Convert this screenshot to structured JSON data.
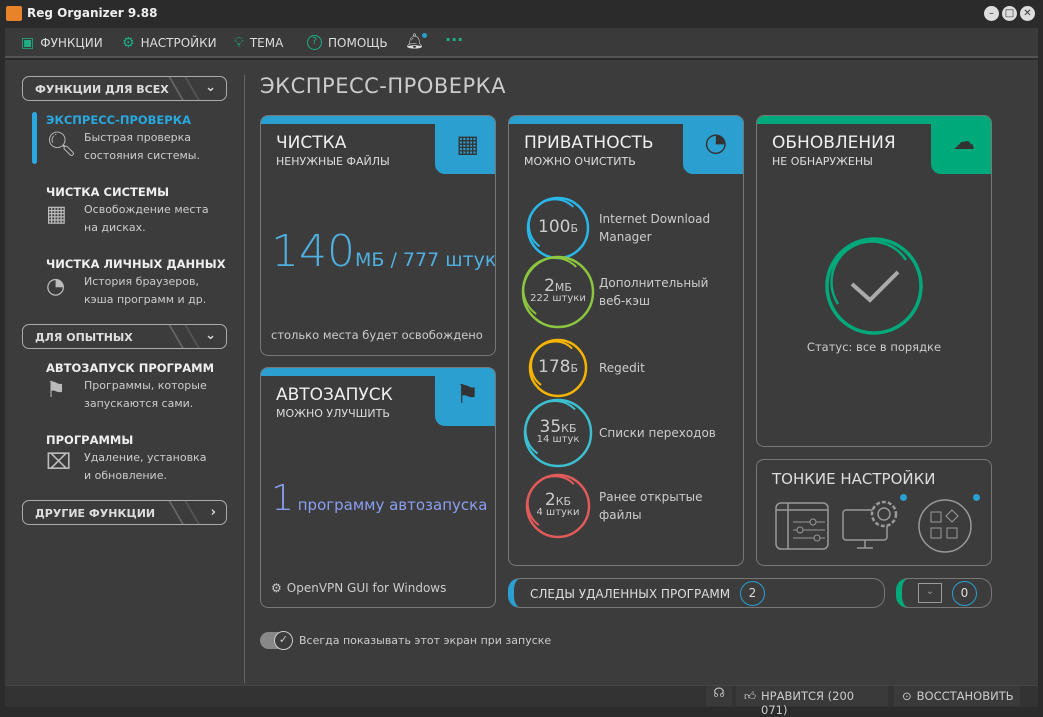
{
  "window": {
    "title": "Reg Organizer 9.88"
  },
  "menu": [
    {
      "label": "ФУНКЦИИ",
      "icon": "briefcase-icon"
    },
    {
      "label": "НАСТРОЙКИ",
      "icon": "gear-icon"
    },
    {
      "label": "ТЕМА",
      "icon": "lightbulb-icon"
    },
    {
      "label": "ПОМОЩЬ",
      "icon": "help-icon"
    }
  ],
  "sidebar": {
    "group1": "ФУНКЦИИ ДЛЯ ВСЕХ",
    "group2": "ДЛЯ ОПЫТНЫХ",
    "group3": "ДРУГИЕ ФУНКЦИИ",
    "items": [
      {
        "title": "ЭКСПРЕСС-ПРОВЕРКА",
        "desc1": "Быстрая проверка",
        "desc2": "состояния системы."
      },
      {
        "title": "ЧИСТКА СИСТЕМЫ",
        "desc1": "Освобождение места",
        "desc2": "на дисках."
      },
      {
        "title": "ЧИСТКА ЛИЧНЫХ ДАННЫХ",
        "desc1": "История браузеров,",
        "desc2": "кэша программ и др."
      },
      {
        "title": "АВТОЗАПУСК ПРОГРАММ",
        "desc1": "Программы, которые",
        "desc2": "запускаются сами."
      },
      {
        "title": "ПРОГРАММЫ",
        "desc1": "Удаление, установка",
        "desc2": "и обновление."
      }
    ]
  },
  "page_title": "ЭКСПРЕСС-ПРОВЕРКА",
  "cleanup": {
    "title": "ЧИСТКА",
    "subtitle": "НЕНУЖНЫЕ ФАЙЛЫ",
    "size": "140",
    "size_unit": "МБ / 777 штук",
    "note": "столько места будет освобождено"
  },
  "autorun": {
    "title": "АВТОЗАПУСК",
    "subtitle": "МОЖНО УЛУЧШИТЬ",
    "count": "1",
    "count_label": "программу автозапуска",
    "item": "OpenVPN GUI for Windows"
  },
  "privacy": {
    "title": "ПРИВАТНОСТЬ",
    "subtitle": "МОЖНО ОЧИСТИТЬ",
    "items": [
      {
        "value": "100",
        "unit": "Б",
        "count": "",
        "label1": "Internet Download",
        "label2": "Manager",
        "color": "#29b6e8"
      },
      {
        "value": "2",
        "unit": "МБ",
        "count": "222 штуки",
        "label1": "Дополнительный",
        "label2": "веб-кэш",
        "color": "#8cc63f"
      },
      {
        "value": "178",
        "unit": "Б",
        "count": "",
        "label1": "Regedit",
        "label2": "",
        "color": "#f5b400"
      },
      {
        "value": "35",
        "unit": "КБ",
        "count": "14 штук",
        "label1": "Списки переходов",
        "label2": "",
        "color": "#3cbfd0"
      },
      {
        "value": "2",
        "unit": "КБ",
        "count": "4 штуки",
        "label1": "Ранее открытые",
        "label2": "файлы",
        "color": "#e05a5a"
      }
    ]
  },
  "updates": {
    "title": "ОБНОВЛЕНИЯ",
    "subtitle": "НЕ ОБНАРУЖЕНЫ",
    "status": "Статус: все в порядке"
  },
  "tweaks": {
    "title": "ТОНКИЕ НАСТРОЙКИ"
  },
  "traces": {
    "label": "СЛЕДЫ УДАЛЕННЫХ ПРОГРАММ",
    "count": "2"
  },
  "memory": {
    "count": "0"
  },
  "show_on_start": {
    "label": "Всегда показывать этот экран при запуске",
    "checked": true
  },
  "statusbar": {
    "like": "НРАВИТСЯ (200 071)",
    "restore": "ВОССТАНОВИТЬ"
  },
  "colors": {
    "accent_blue": "#2a9fd0",
    "accent_green": "#00a97a"
  }
}
